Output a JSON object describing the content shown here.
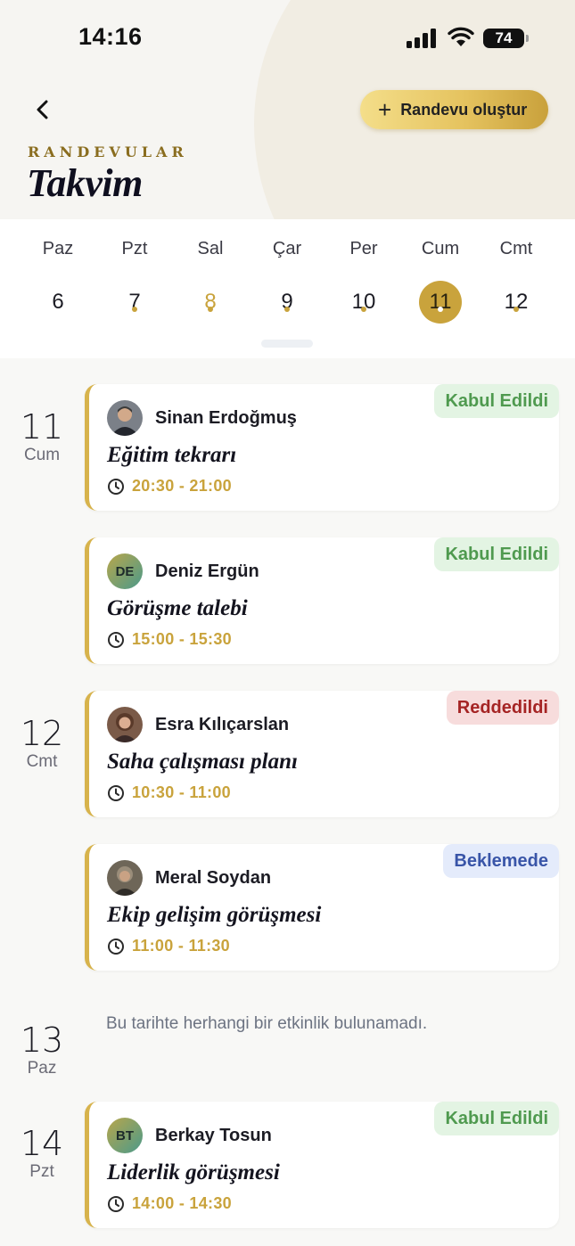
{
  "status_bar": {
    "time": "14:16",
    "battery": "74"
  },
  "header": {
    "overline": "RANDEVULAR",
    "title": "Takvim",
    "create_label": "Randevu oluştur"
  },
  "week": [
    {
      "name": "Paz",
      "num": "6"
    },
    {
      "name": "Pzt",
      "num": "7"
    },
    {
      "name": "Sal",
      "num": "8"
    },
    {
      "name": "Çar",
      "num": "9"
    },
    {
      "name": "Per",
      "num": "10"
    },
    {
      "name": "Cum",
      "num": "11"
    },
    {
      "name": "Cmt",
      "num": "12"
    }
  ],
  "dates": [
    {
      "num": "11",
      "day": "Cum"
    },
    {
      "num": "12",
      "day": "Cmt"
    },
    {
      "num": "13",
      "day": "Paz"
    },
    {
      "num": "14",
      "day": "Pzt"
    }
  ],
  "appointments": [
    {
      "person": "Sinan Erdoğmuş",
      "title": "Eğitim tekrarı",
      "time": "20:30 - 21:00",
      "status": "Kabul Edildi"
    },
    {
      "person": "Deniz Ergün",
      "initials": "DE",
      "title": "Görüşme talebi",
      "time": "15:00 - 15:30",
      "status": "Kabul Edildi"
    },
    {
      "person": "Esra Kılıçarslan",
      "title": "Saha çalışması planı",
      "time": "10:30 - 11:00",
      "status": "Reddedildi"
    },
    {
      "person": "Meral Soydan",
      "title": "Ekip gelişim görüşmesi",
      "time": "11:00 - 11:30",
      "status": "Beklemede"
    },
    {
      "person": "Berkay Tosun",
      "initials": "BT",
      "title": "Liderlik görüşmesi",
      "time": "14:00 - 14:30",
      "status": "Kabul Edildi"
    }
  ],
  "empty_message": "Bu tarihte herhangi bir etkinlik bulunamadı.",
  "colors": {
    "accent": "#c9a33c",
    "accepted": "#4f9a4f",
    "rejected": "#a52424",
    "pending": "#3955a8"
  }
}
